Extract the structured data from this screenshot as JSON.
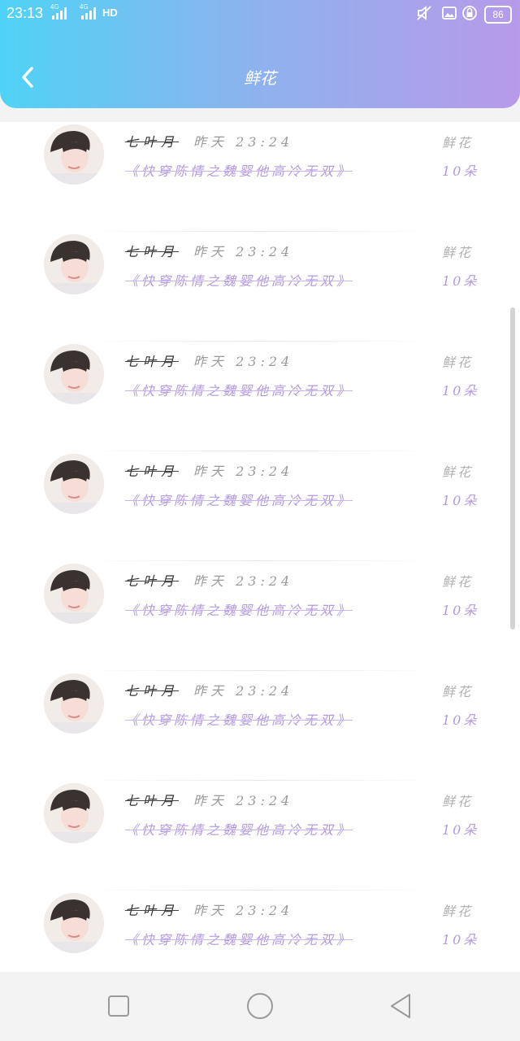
{
  "status_bar": {
    "time": "23:13",
    "network_1": "4G",
    "network_2": "4G",
    "hd_label": "HD",
    "battery": "86"
  },
  "header": {
    "title": "鲜花",
    "back_icon": "chevron-left-icon"
  },
  "list": [
    {
      "name": "七叶月",
      "time": "昨天 23:24",
      "novel": "《快穿陈情之魏婴他高冷无双》",
      "gift": "鲜花",
      "count": "10朵"
    },
    {
      "name": "七叶月",
      "time": "昨天 23:24",
      "novel": "《快穿陈情之魏婴他高冷无双》",
      "gift": "鲜花",
      "count": "10朵"
    },
    {
      "name": "七叶月",
      "time": "昨天 23:24",
      "novel": "《快穿陈情之魏婴他高冷无双》",
      "gift": "鲜花",
      "count": "10朵"
    },
    {
      "name": "七叶月",
      "time": "昨天 23:24",
      "novel": "《快穿陈情之魏婴他高冷无双》",
      "gift": "鲜花",
      "count": "10朵"
    },
    {
      "name": "七叶月",
      "time": "昨天 23:24",
      "novel": "《快穿陈情之魏婴他高冷无双》",
      "gift": "鲜花",
      "count": "10朵"
    },
    {
      "name": "七叶月",
      "time": "昨天 23:24",
      "novel": "《快穿陈情之魏婴他高冷无双》",
      "gift": "鲜花",
      "count": "10朵"
    },
    {
      "name": "七叶月",
      "time": "昨天 23:24",
      "novel": "《快穿陈情之魏婴他高冷无双》",
      "gift": "鲜花",
      "count": "10朵"
    },
    {
      "name": "七叶月",
      "time": "昨天 23:24",
      "novel": "《快穿陈情之魏婴他高冷无双》",
      "gift": "鲜花",
      "count": "10朵"
    }
  ],
  "nav_bar": {
    "recents_icon": "square-icon",
    "home_icon": "circle-icon",
    "back_icon": "triangle-back-icon"
  },
  "colors": {
    "header_gradient_start": "#4fd3f6",
    "header_gradient_end": "#b79aea",
    "accent_purple": "#b39ae0"
  }
}
